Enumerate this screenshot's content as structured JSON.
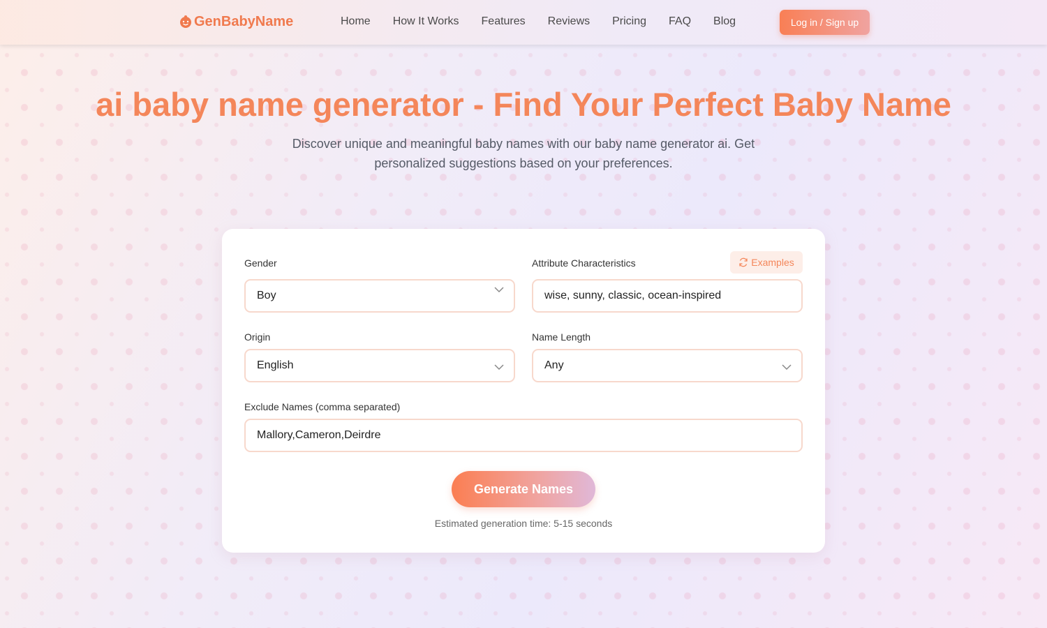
{
  "header": {
    "logo_text": "GenBabyName",
    "nav": [
      "Home",
      "How It Works",
      "Features",
      "Reviews",
      "Pricing",
      "FAQ",
      "Blog"
    ],
    "login_label": "Log in / Sign up"
  },
  "hero": {
    "title": "ai baby name generator - Find Your Perfect Baby Name",
    "subtitle": "Discover unique and meaningful baby names with our baby name generator ai. Get personalized suggestions based on your preferences."
  },
  "form": {
    "gender": {
      "label": "Gender",
      "value": "Boy"
    },
    "attributes": {
      "label": "Attribute Characteristics",
      "value": "wise, sunny, classic, ocean-inspired",
      "examples_label": "Examples"
    },
    "origin": {
      "label": "Origin",
      "value": "English"
    },
    "length": {
      "label": "Name Length",
      "value": "Any"
    },
    "exclude": {
      "label": "Exclude Names (comma separated)",
      "value": "Mallory,Cameron,Deirdre"
    },
    "generate_label": "Generate Names",
    "estimate": "Estimated generation time: 5-15 seconds"
  },
  "colors": {
    "accent": "#f4865a",
    "border": "#f7d8cc"
  }
}
